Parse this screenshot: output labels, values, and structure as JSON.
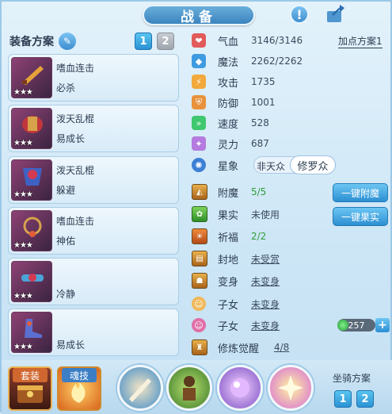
{
  "header": {
    "title": "战备"
  },
  "left": {
    "equip_scheme_label": "装备方案",
    "scheme_buttons": [
      "1",
      "2"
    ],
    "items": [
      {
        "name": "嗜血连击",
        "subtitle": "必杀",
        "stars": "★★★"
      },
      {
        "name": "泼天乱棍",
        "subtitle": "易成长",
        "stars": "★★★"
      },
      {
        "name": "泼天乱棍",
        "subtitle": "躲避",
        "stars": "★★★"
      },
      {
        "name": "嗜血连击",
        "subtitle": "神佑",
        "stars": "★★★"
      },
      {
        "name": "",
        "subtitle": "冷静",
        "stars": "★★★"
      },
      {
        "name": "",
        "subtitle": "易成长",
        "stars": "★★★"
      }
    ]
  },
  "stats": {
    "plan_link": "加点方案1",
    "rows": [
      {
        "label": "气血",
        "value": "3146/3146",
        "icon": "heart-icon"
      },
      {
        "label": "魔法",
        "value": "2262/2262",
        "icon": "mana-icon"
      },
      {
        "label": "攻击",
        "value": "1735",
        "icon": "attack-icon"
      },
      {
        "label": "防御",
        "value": "1001",
        "icon": "defense-icon"
      },
      {
        "label": "速度",
        "value": "528",
        "icon": "speed-icon"
      },
      {
        "label": "灵力",
        "value": "687",
        "icon": "spirit-icon"
      }
    ],
    "xingxiang": {
      "label": "星象",
      "option_a": "非天众",
      "option_b": "修罗众"
    },
    "extra": [
      {
        "label": "附魔",
        "value": "5/5"
      },
      {
        "label": "果实",
        "value": "未使用"
      },
      {
        "label": "祈福",
        "value": "2/2"
      },
      {
        "label": "封地",
        "value": "未受赏"
      },
      {
        "label": "变身",
        "value": "未变身"
      },
      {
        "label": "子女",
        "value": "未变身"
      },
      {
        "label": "子女",
        "value": "未变身"
      },
      {
        "label": "修炼觉醒",
        "value": "4/8"
      }
    ],
    "buttons": {
      "enchant": "一键附魔",
      "fruit": "一键果实"
    },
    "counter": "257",
    "plus": "+"
  },
  "bottom": {
    "tabs": [
      "套装",
      "魂技"
    ],
    "mount_title": "坐骑方案",
    "mount_buttons": [
      "1",
      "2"
    ]
  }
}
